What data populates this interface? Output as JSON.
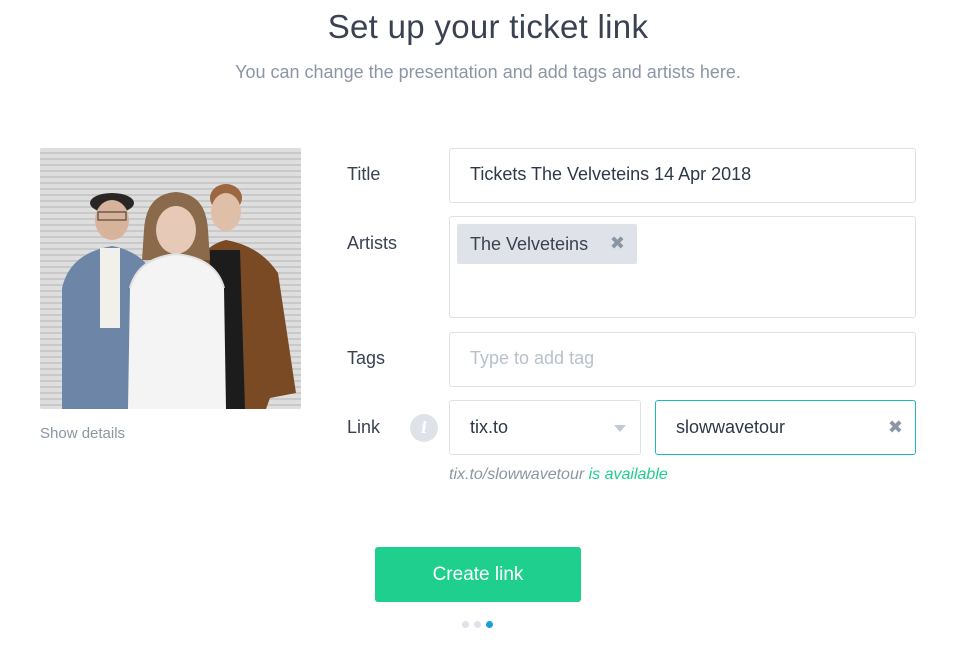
{
  "header": {
    "title": "Set up your ticket link",
    "subtitle": "You can change the presentation and add tags and artists here."
  },
  "photo": {
    "show_details_label": "Show details"
  },
  "form": {
    "title_label": "Title",
    "title_value": "Tickets The Velveteins 14 Apr 2018",
    "artists_label": "Artists",
    "artists": [
      {
        "name": "The Velveteins",
        "remove_glyph": "✖"
      }
    ],
    "tags_label": "Tags",
    "tags_placeholder": "Type to add tag",
    "link_label": "Link",
    "info_glyph": "i",
    "domain_value": "tix.to",
    "slug_value": "slowwavetour",
    "slug_clear_glyph": "✖",
    "availability_url": "tix.to/slowwavetour",
    "availability_status": "is available"
  },
  "actions": {
    "create_label": "Create link"
  },
  "progress": {
    "total_steps": 3,
    "current_step": 3
  },
  "colors": {
    "primary": "#1ecf8e",
    "focus_border": "#1db8c7",
    "active_dot": "#1a9fd8",
    "muted_text": "#8b96a4",
    "chip_bg": "#dfe3e9"
  }
}
